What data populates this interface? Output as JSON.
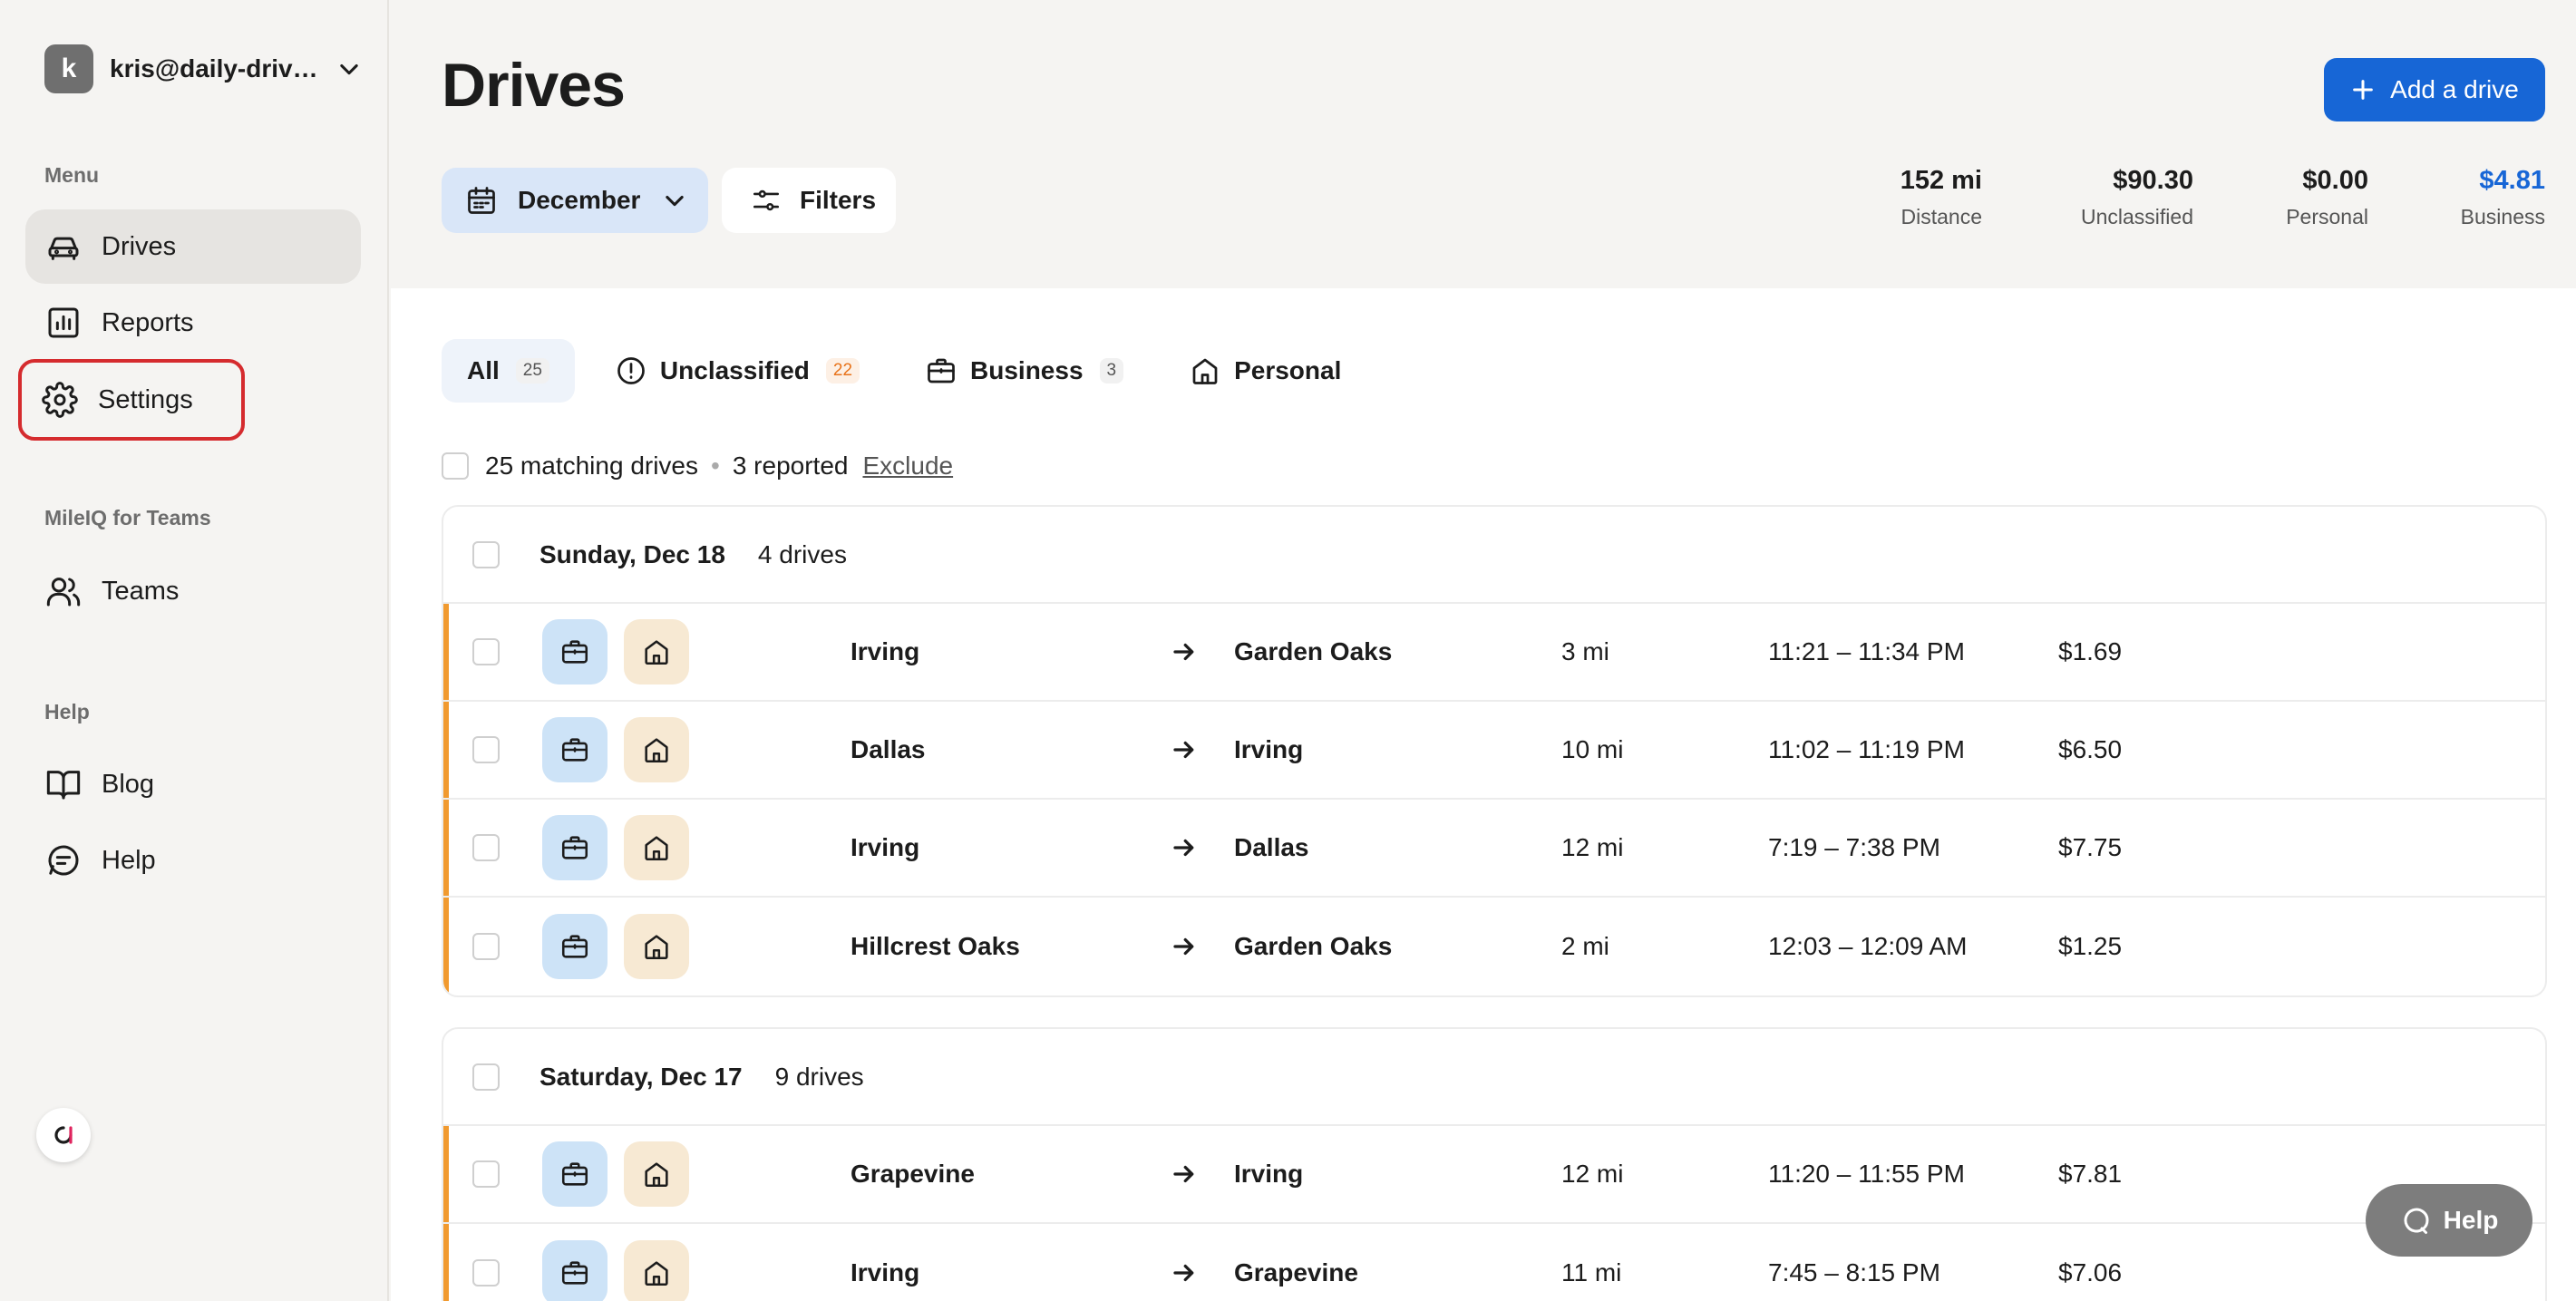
{
  "account": {
    "initial": "k",
    "email": "kris@daily-drive..."
  },
  "sidebar": {
    "menu_heading": "Menu",
    "items": [
      {
        "label": "Drives",
        "icon": "car-icon"
      },
      {
        "label": "Reports",
        "icon": "chart-icon"
      },
      {
        "label": "Settings",
        "icon": "gear-icon"
      }
    ],
    "teams_heading": "MileIQ for Teams",
    "teams_item": "Teams",
    "help_heading": "Help",
    "help_items": [
      {
        "label": "Blog",
        "icon": "book-icon"
      },
      {
        "label": "Help",
        "icon": "chat-icon"
      }
    ]
  },
  "header": {
    "title": "Drives",
    "add_button": "Add a drive",
    "month": "December",
    "filters": "Filters",
    "stats": [
      {
        "value": "152 mi",
        "label": "Distance"
      },
      {
        "value": "$90.30",
        "label": "Unclassified"
      },
      {
        "value": "$0.00",
        "label": "Personal"
      },
      {
        "value": "$4.81",
        "label": "Business"
      }
    ]
  },
  "tabs": [
    {
      "label": "All",
      "count": "25"
    },
    {
      "label": "Unclassified",
      "count": "22"
    },
    {
      "label": "Business",
      "count": "3"
    },
    {
      "label": "Personal",
      "count": ""
    }
  ],
  "selection": {
    "matching": "25 matching drives",
    "reported": "3 reported",
    "exclude": "Exclude"
  },
  "groups": [
    {
      "date": "Sunday, Dec 18",
      "count": "4 drives",
      "drives": [
        {
          "from": "Irving",
          "to": "Garden Oaks",
          "distance": "3 mi",
          "time": "11:21 – 11:34 PM",
          "amount": "$1.69"
        },
        {
          "from": "Dallas",
          "to": "Irving",
          "distance": "10 mi",
          "time": "11:02 – 11:19 PM",
          "amount": "$6.50"
        },
        {
          "from": "Irving",
          "to": "Dallas",
          "distance": "12 mi",
          "time": "7:19 – 7:38 PM",
          "amount": "$7.75"
        },
        {
          "from": "Hillcrest Oaks",
          "to": "Garden Oaks",
          "distance": "2 mi",
          "time": "12:03 – 12:09 AM",
          "amount": "$1.25"
        }
      ]
    },
    {
      "date": "Saturday, Dec 17",
      "count": "9 drives",
      "drives": [
        {
          "from": "Grapevine",
          "to": "Irving",
          "distance": "12 mi",
          "time": "11:20 – 11:55 PM",
          "amount": "$7.81"
        },
        {
          "from": "Irving",
          "to": "Grapevine",
          "distance": "11 mi",
          "time": "7:45 – 8:15 PM",
          "amount": "$7.06"
        }
      ]
    }
  ],
  "help_bubble": "Help",
  "colors": {
    "accent": "#1766d6",
    "business_stat": "#1766d6",
    "unclassified_stripe": "#f19a2f",
    "highlight_outline": "#d52b2e"
  }
}
